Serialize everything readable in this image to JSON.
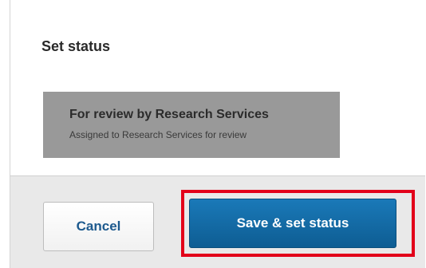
{
  "dialog": {
    "title": "Set status"
  },
  "status_option": {
    "name": "For review by Research Services",
    "description": "Assigned to Research Services for review",
    "background_color": "#999999"
  },
  "footer": {
    "cancel_label": "Cancel",
    "save_label": "Save & set status",
    "save_color": "#1266a3",
    "highlight_color": "#e2001a"
  }
}
